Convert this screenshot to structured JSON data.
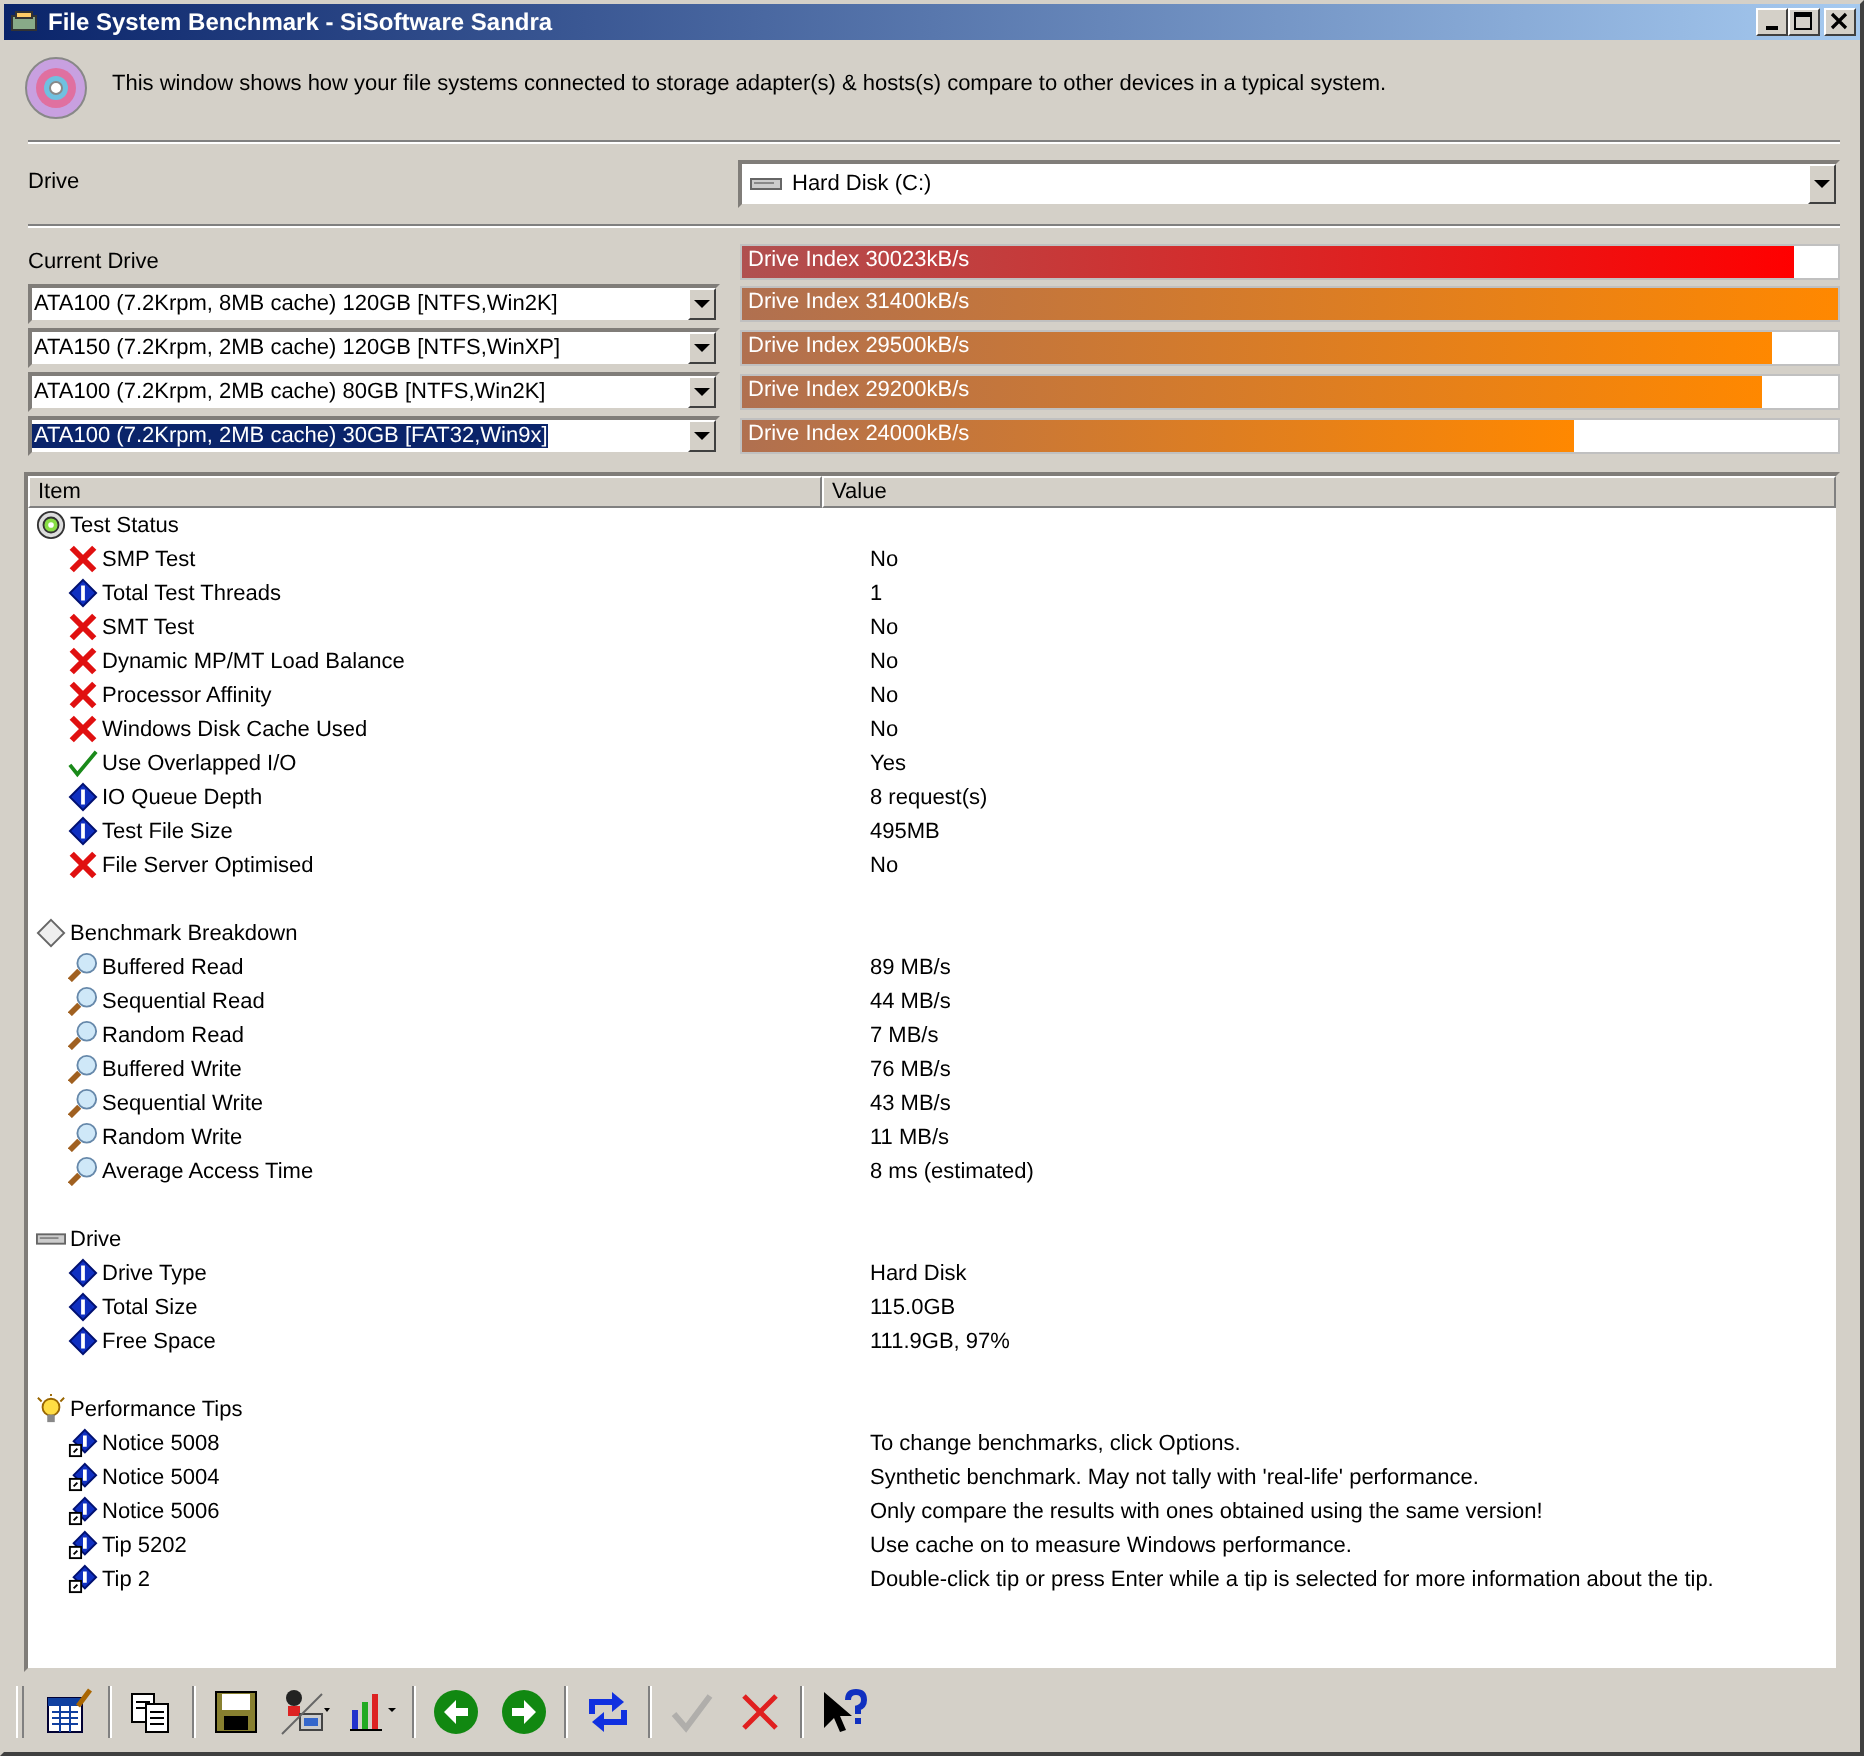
{
  "window": {
    "title": "File System Benchmark - SiSoftware Sandra"
  },
  "intro": "This window shows how your file systems connected to storage adapter(s) & hosts(s) compare to other devices in a typical system.",
  "drive": {
    "label": "Drive",
    "value": "Hard Disk (C:)"
  },
  "current_drive": {
    "label": "Current Drive",
    "bar_text": "Drive Index 30023kB/s",
    "level": 0.96
  },
  "comparisons": [
    {
      "value": "ATA100 (7.2Krpm, 8MB cache) 120GB [NTFS,Win2K]",
      "selected": false,
      "bar_text": "Drive Index 31400kB/s",
      "level": 1.0
    },
    {
      "value": "ATA150 (7.2Krpm, 2MB cache) 120GB [NTFS,WinXP]",
      "selected": false,
      "bar_text": "Drive Index 29500kB/s",
      "level": 0.94
    },
    {
      "value": "ATA100 (7.2Krpm, 2MB cache) 80GB [NTFS,Win2K]",
      "selected": false,
      "bar_text": "Drive Index 29200kB/s",
      "level": 0.93
    },
    {
      "value": "ATA100 (7.2Krpm, 2MB cache) 30GB [FAT32,Win9x]",
      "selected": true,
      "bar_text": "Drive Index 24000kB/s",
      "level": 0.76
    }
  ],
  "table": {
    "columns": [
      "Item",
      "Value"
    ],
    "sections": [
      {
        "title": "Test Status",
        "kind": "status",
        "rows": [
          {
            "kind": "cross",
            "item": "SMP Test",
            "value": "No"
          },
          {
            "kind": "info",
            "item": "Total Test Threads",
            "value": "1"
          },
          {
            "kind": "cross",
            "item": "SMT Test",
            "value": "No"
          },
          {
            "kind": "cross",
            "item": "Dynamic MP/MT Load Balance",
            "value": "No"
          },
          {
            "kind": "cross",
            "item": "Processor Affinity",
            "value": "No"
          },
          {
            "kind": "cross",
            "item": "Windows Disk Cache Used",
            "value": "No"
          },
          {
            "kind": "check",
            "item": "Use Overlapped I/O",
            "value": "Yes"
          },
          {
            "kind": "info",
            "item": "IO Queue Depth",
            "value": "8 request(s)"
          },
          {
            "kind": "info",
            "item": "Test File Size",
            "value": "495MB"
          },
          {
            "kind": "cross",
            "item": "File Server Optimised",
            "value": "No"
          }
        ]
      },
      {
        "title": "Benchmark Breakdown",
        "kind": "diamond",
        "rows": [
          {
            "kind": "magnifier",
            "item": "Buffered Read",
            "value": "89 MB/s"
          },
          {
            "kind": "magnifier",
            "item": "Sequential Read",
            "value": "44 MB/s"
          },
          {
            "kind": "magnifier",
            "item": "Random Read",
            "value": "7 MB/s"
          },
          {
            "kind": "magnifier",
            "item": "Buffered Write",
            "value": "76 MB/s"
          },
          {
            "kind": "magnifier",
            "item": "Sequential Write",
            "value": "43 MB/s"
          },
          {
            "kind": "magnifier",
            "item": "Random Write",
            "value": "11 MB/s"
          },
          {
            "kind": "magnifier",
            "item": "Average Access Time",
            "value": "8 ms (estimated)"
          }
        ]
      },
      {
        "title": "Drive",
        "kind": "drive",
        "rows": [
          {
            "kind": "info",
            "item": "Drive Type",
            "value": "Hard Disk"
          },
          {
            "kind": "info",
            "item": "Total Size",
            "value": "115.0GB"
          },
          {
            "kind": "info",
            "item": "Free Space",
            "value": "111.9GB, 97%"
          }
        ]
      },
      {
        "title": "Performance Tips",
        "kind": "bulb",
        "rows": [
          {
            "kind": "tip",
            "item": "Notice 5008",
            "value": "To change benchmarks, click Options."
          },
          {
            "kind": "tip",
            "item": "Notice 5004",
            "value": "Synthetic benchmark. May not tally with 'real-life' performance."
          },
          {
            "kind": "tip",
            "item": "Notice 5006",
            "value": "Only compare the results with ones obtained using the same version!"
          },
          {
            "kind": "tip",
            "item": "Tip 5202",
            "value": "Use cache on to measure Windows performance."
          },
          {
            "kind": "tip",
            "item": "Tip 2",
            "value": "Double-click tip or press Enter while a tip is selected for more information about the tip."
          }
        ]
      }
    ]
  },
  "toolbar": [
    {
      "kind": "properties",
      "disabled": false
    },
    {
      "kind": "copy",
      "disabled": false
    },
    {
      "kind": "save",
      "disabled": false
    },
    {
      "kind": "computer",
      "disabled": false
    },
    {
      "kind": "chart",
      "disabled": false
    },
    {
      "kind": "back",
      "disabled": false
    },
    {
      "kind": "forward",
      "disabled": false
    },
    {
      "kind": "refresh",
      "disabled": false
    },
    {
      "kind": "ok",
      "disabled": true
    },
    {
      "kind": "cancel",
      "disabled": false
    },
    {
      "kind": "help",
      "disabled": false
    }
  ]
}
